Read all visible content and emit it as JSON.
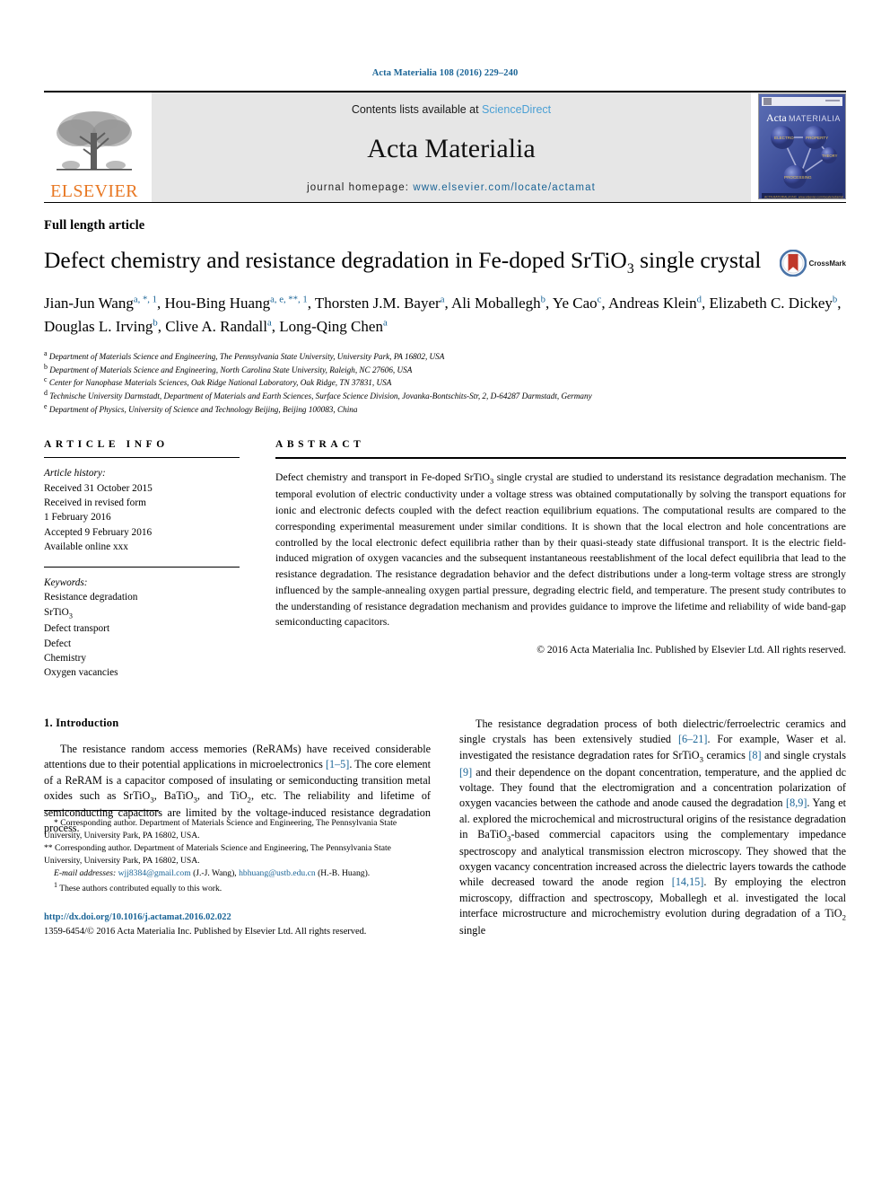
{
  "running_head": "Acta Materialia 108 (2016) 229–240",
  "masthead": {
    "publisher_name": "ELSEVIER",
    "contents_prefix": "Contents lists available at ",
    "contents_link": "ScienceDirect",
    "journal_name": "Acta Materialia",
    "homepage_prefix": "journal homepage: ",
    "homepage_url": "www.elsevier.com/locate/actamat",
    "cover_title_1": "Acta",
    "cover_title_2": "MATERIALIA",
    "cover_nodes": [
      "ELECTRO",
      "PROPERTY",
      "THEORY",
      "PROCESSING"
    ]
  },
  "article": {
    "type": "Full length article",
    "title_part1": "Defect chemistry and resistance degradation in Fe-doped SrTiO",
    "title_sub": "3",
    "title_part2": " single crystal",
    "crossmark_label": "CrossMark"
  },
  "authors": {
    "line1": "Jian-Jun Wang",
    "line1_sup": "a, *, 1",
    "a2": "Hou-Bing Huang",
    "a2_sup": "a, e, **, 1",
    "a3": "Thorsten J.M. Bayer",
    "a3_sup": "a",
    "a4": "Ali Moballegh",
    "a4_sup": "b",
    "a5": "Ye Cao",
    "a5_sup": "c",
    "a6": "Andreas Klein",
    "a6_sup": "d",
    "a7": "Elizabeth C. Dickey",
    "a7_sup": "b",
    "a8": "Douglas L. Irving",
    "a8_sup": "b",
    "a9": "Clive A. Randall",
    "a9_sup": "a",
    "a10": "Long-Qing Chen",
    "a10_sup": "a"
  },
  "affiliations": [
    {
      "mark": "a",
      "text": "Department of Materials Science and Engineering, The Pennsylvania State University, University Park, PA 16802, USA"
    },
    {
      "mark": "b",
      "text": "Department of Materials Science and Engineering, North Carolina State University, Raleigh, NC 27606, USA"
    },
    {
      "mark": "c",
      "text": "Center for Nanophase Materials Sciences, Oak Ridge National Laboratory, Oak Ridge, TN 37831, USA"
    },
    {
      "mark": "d",
      "text": "Technische University Darmstadt, Department of Materials and Earth Sciences, Surface Science Division, Jovanka-Bontschits-Str, 2, D-64287 Darmstadt, Germany"
    },
    {
      "mark": "e",
      "text": "Department of Physics, University of Science and Technology Beijing, Beijing 100083, China"
    }
  ],
  "article_info": {
    "heading": "ARTICLE INFO",
    "history_label": "Article history:",
    "history": [
      "Received 31 October 2015",
      "Received in revised form",
      "1 February 2016",
      "Accepted 9 February 2016",
      "Available online xxx"
    ],
    "keywords_label": "Keywords:",
    "keywords": [
      "Resistance degradation",
      "SrTiO3",
      "Defect transport",
      "Defect",
      "Chemistry",
      "Oxygen vacancies"
    ]
  },
  "abstract": {
    "heading": "ABSTRACT",
    "body_1": "Defect chemistry and transport in Fe-doped SrTiO",
    "body_sub": "3",
    "body_2": " single crystal are studied to understand its resistance degradation mechanism. The temporal evolution of electric conductivity under a voltage stress was obtained computationally by solving the transport equations for ionic and electronic defects coupled with the defect reaction equilibrium equations. The computational results are compared to the corresponding experimental measurement under similar conditions. It is shown that the local electron and hole concentrations are controlled by the local electronic defect equilibria rather than by their quasi-steady state diffusional transport. It is the electric field-induced migration of oxygen vacancies and the subsequent instantaneous reestablishment of the local defect equilibria that lead to the resistance degradation. The resistance degradation behavior and the defect distributions under a long-term voltage stress are strongly influenced by the sample-annealing oxygen partial pressure, degrading electric field, and temperature. The present study contributes to the understanding of resistance degradation mechanism and provides guidance to improve the lifetime and reliability of wide band-gap semiconducting capacitors.",
    "copyright": "© 2016 Acta Materialia Inc. Published by Elsevier Ltd. All rights reserved."
  },
  "introduction": {
    "heading": "1. Introduction",
    "para1_a": "The resistance random access memories (ReRAMs) have received considerable attentions due to their potential applications in microelectronics ",
    "para1_ref1": "[1–5]",
    "para1_b": ". The core element of a ReRAM is a capacitor composed of insulating or semiconducting transition metal oxides such as SrTiO",
    "para1_sub1": "3",
    "para1_c": ", BaTiO",
    "para1_sub2": "3",
    "para1_d": ", and TiO",
    "para1_sub3": "2",
    "para1_e": ", etc. The reliability and lifetime of semiconducting capacitors are limited by the voltage-induced resistance degradation process."
  },
  "right_column": {
    "p_a": "The resistance degradation process of both dielectric/ferroelectric ceramics and single crystals has been extensively studied ",
    "ref_6_21": "[6–21]",
    "p_b": ". For example, Waser et al. investigated the resistance degradation rates for SrTiO",
    "sub_3a": "3",
    "p_c": " ceramics ",
    "ref_8": "[8]",
    "p_d": " and single crystals ",
    "ref_9": "[9]",
    "p_e": " and their dependence on the dopant concentration, temperature, and the applied dc voltage. They found that the electromigration and a concentration polarization of oxygen vacancies between the cathode and anode caused the degradation ",
    "ref_89": "[8,9]",
    "p_f": ". Yang et al. explored the microchemical and microstructural origins of the resistance degradation in BaTiO",
    "sub_3b": "3",
    "p_g": "-based commercial capacitors using the complementary impedance spectroscopy and analytical transmission electron microscopy. They showed that the oxygen vacancy concentration increased across the dielectric layers towards the cathode while decreased toward the anode region ",
    "ref_1415": "[14,15]",
    "p_h": ". By employing the electron microscopy, diffraction and spectroscopy, Moballegh et al. investigated the local interface microstructure and microchemistry evolution during degradation of a TiO",
    "sub_2": "2",
    "p_i": " single"
  },
  "footnotes": {
    "star": "* Corresponding author. Department of Materials Science and Engineering, The Pennsylvania State University, University Park, PA 16802, USA.",
    "dstar": "** Corresponding author. Department of Materials Science and Engineering, The Pennsylvania State University, University Park, PA 16802, USA.",
    "email_label": "E-mail addresses:",
    "email1": "wjj8384@gmail.com",
    "email1_owner": "(J.-J. Wang),",
    "email2": "hbhuang@ustb.edu.cn",
    "email2_owner": "(H.-B. Huang).",
    "equal_mark": "1",
    "equal": "These authors contributed equally to this work."
  },
  "doi": {
    "url": "http://dx.doi.org/10.1016/j.actamat.2016.02.022",
    "issn_line": "1359-6454/© 2016 Acta Materialia Inc. Published by Elsevier Ltd. All rights reserved."
  },
  "colors": {
    "link": "#1a6496",
    "sciencedirect": "#4a9fd4",
    "elsevier_orange": "#E87722",
    "masthead_bg": "#e6e6e6",
    "crossmark_blue": "#3a6ea5",
    "crossmark_red": "#c0392b"
  }
}
